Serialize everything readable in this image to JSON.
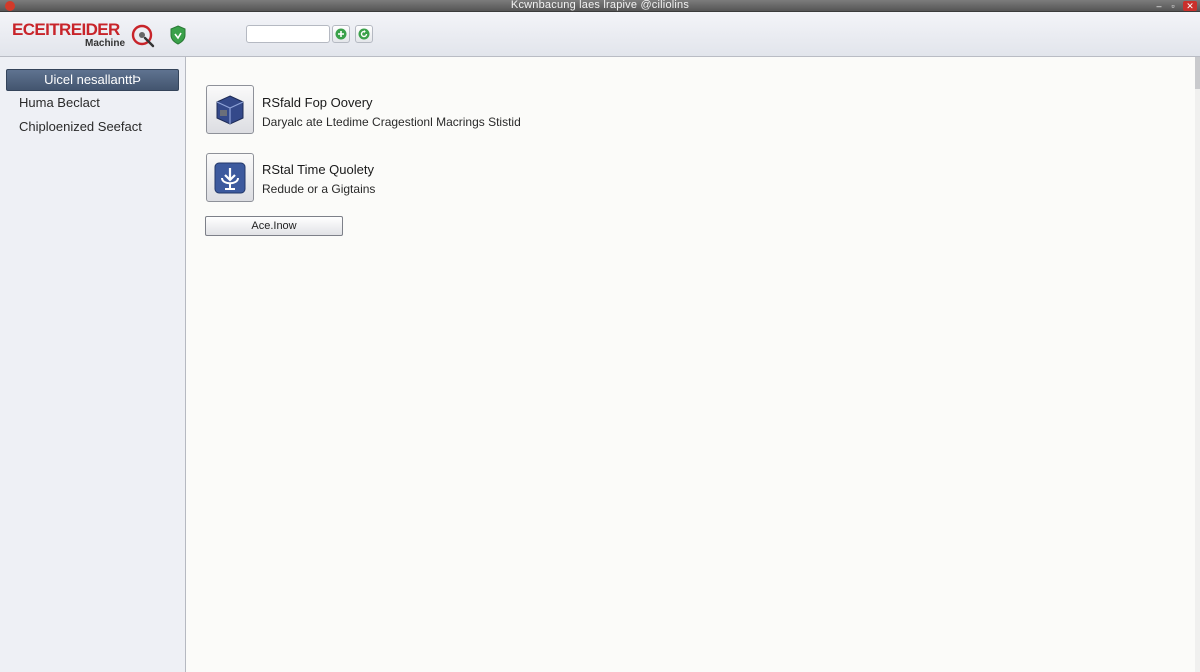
{
  "window": {
    "title": "Kcwnbacung laes lrapive @ciliolins",
    "min_glyph": "–",
    "max_glyph": "▫",
    "close_glyph": "✕"
  },
  "brand": {
    "name": "ECEITREIDER",
    "sub": "Machine",
    "accent_color": "#c8242a"
  },
  "toolbar": {
    "search_value": "",
    "search_placeholder": ""
  },
  "sidebar": {
    "selected_label": "Uicel nesallanttÞ",
    "items": [
      {
        "label": "Huma Beclact"
      },
      {
        "label": "Chiploenized Seefact"
      }
    ]
  },
  "main": {
    "items": [
      {
        "title": "RSfald Fop Oovery",
        "description": "Daryalc ate Ltedime Cragestionl Macrings Stistid",
        "icon": "cube-icon"
      },
      {
        "title": "RStal Time Quolety",
        "description": "Redude or a Gigtains",
        "icon": "download-icon"
      }
    ],
    "action_label": "Ace.Inow"
  },
  "colors": {
    "sidebar_selected": "#4d5f7a",
    "toolbar_green": "#3aa14a"
  }
}
